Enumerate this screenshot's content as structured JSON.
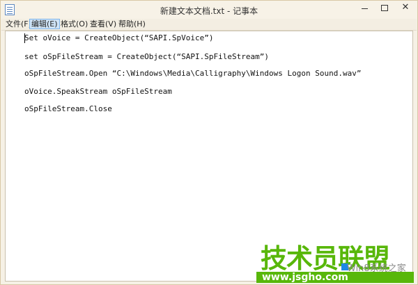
{
  "window": {
    "title": "新建文本文档.txt - 记事本",
    "close_glyph": "✕"
  },
  "menu": {
    "items": [
      "文件(F)",
      "编辑(E)",
      "格式(O)",
      "查看(V)",
      "帮助(H)"
    ],
    "active_index": 1
  },
  "editor": {
    "lines": [
      "Set oVoice = CreateObject(“SAPI.SpVoice”)",
      "set oSpFileStream = CreateObject(“SAPI.SpFileStream”)",
      "oSpFileStream.Open “C:\\Windows\\Media\\Calligraphy\\Windows Logon Sound.wav”",
      "oVoice.SpeakStream oSpFileStream",
      "oSpFileStream.Close"
    ]
  },
  "watermark": {
    "title": "技术员联盟",
    "subtitle": "Win8系统之家",
    "url": "www.jsgho.com"
  },
  "colors": {
    "watermark_green": "#58b70a",
    "menu_active_bg": "#cfe4f7"
  }
}
